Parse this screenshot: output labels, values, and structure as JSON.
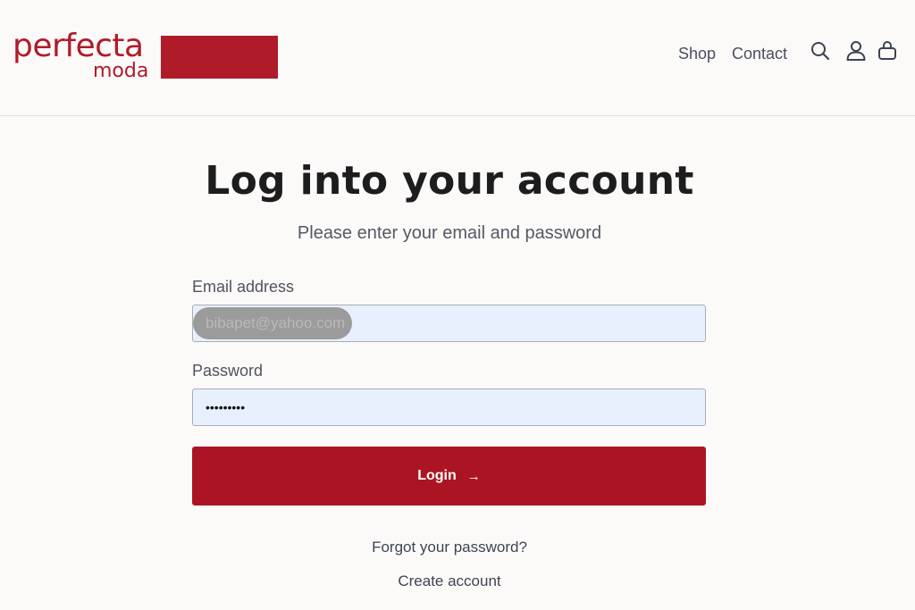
{
  "header": {
    "logo_word1": "perfecta",
    "logo_word2": "moda",
    "nav": [
      {
        "label": "Shop"
      },
      {
        "label": "Contact"
      }
    ],
    "icons": [
      "search-icon",
      "account-icon",
      "cart-icon"
    ]
  },
  "main": {
    "title": "Log into your account",
    "subtitle": "Please enter your email and password",
    "email_label": "Email address",
    "email_value": "bibapet@yahoo.com",
    "password_label": "Password",
    "password_value": "•••••••••",
    "login_label": "Login",
    "login_arrow": "→",
    "forgot_link": "Forgot your password?",
    "create_link": "Create account"
  },
  "colors": {
    "brand": "#b01b2a",
    "button": "#ab1523",
    "input_bg": "#e8f0fe",
    "page_bg": "#fcf9f9"
  }
}
